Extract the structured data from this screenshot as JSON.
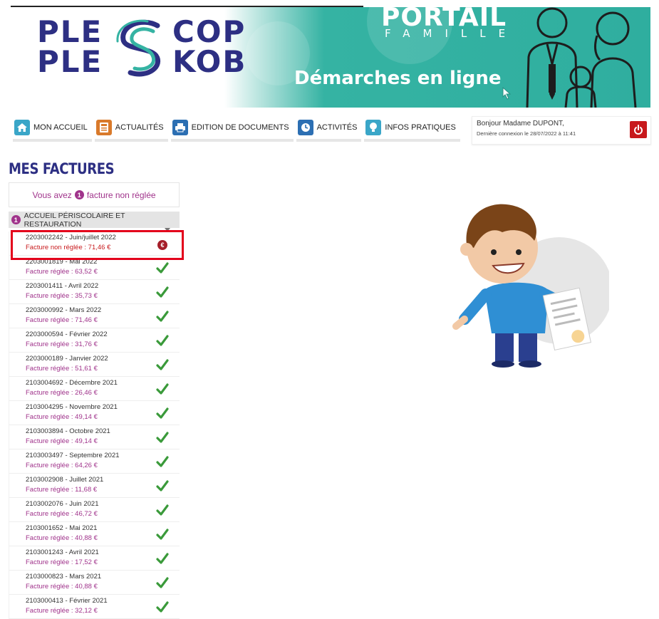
{
  "banner": {
    "logo_line1_left": "PLE",
    "logo_line1_right": "COP",
    "logo_line2_left": "PLE",
    "logo_line2_right": "KOB",
    "portail": "PORTAIL",
    "famille": "FAMILLE",
    "tagline": "Démarches en ligne"
  },
  "nav": {
    "items": [
      {
        "label": "MON ACCUEIL",
        "icon": "home-icon",
        "color": "#3aa6c8"
      },
      {
        "label": "ACTUALITÉS",
        "icon": "news-icon",
        "color": "#d97a2b"
      },
      {
        "label": "EDITION DE DOCUMENTS",
        "icon": "printer-icon",
        "color": "#2c6fb3"
      },
      {
        "label": "ACTIVITÉS",
        "icon": "clock-icon",
        "color": "#2c6fb3"
      },
      {
        "label": "INFOS PRATIQUES",
        "icon": "lightbulb-icon",
        "color": "#3aa6c8"
      }
    ]
  },
  "user": {
    "greeting": "Bonjour Madame DUPONT,",
    "last_connection": "Dernière connexion le 28/07/2022 à 11:41"
  },
  "page": {
    "title": "MES FACTURES",
    "summary_prefix": "Vous avez",
    "summary_count": "1",
    "summary_suffix": "facture non réglée",
    "section_badge": "1",
    "section_label": "ACCUEIL PÉRISCOLAIRE ET RESTAURATION"
  },
  "colors": {
    "brand_blue": "#2d2f83",
    "teal": "#2fae9f",
    "magenta": "#a0338b",
    "red": "#c8191c",
    "green": "#3a9a3a"
  },
  "invoices": [
    {
      "title": "2203002242 - Juin/juillet 2022",
      "status": "Facture non réglée : 71,46 €",
      "paid": false
    },
    {
      "title": "2203001819 - Mai 2022",
      "status": "Facture réglée : 63,52 €",
      "paid": true
    },
    {
      "title": "2203001411 - Avril 2022",
      "status": "Facture réglée : 35,73 €",
      "paid": true
    },
    {
      "title": "2203000992 - Mars 2022",
      "status": "Facture réglée : 71,46 €",
      "paid": true
    },
    {
      "title": "2203000594 - Février 2022",
      "status": "Facture réglée : 31,76 €",
      "paid": true
    },
    {
      "title": "2203000189 - Janvier 2022",
      "status": "Facture réglée : 51,61 €",
      "paid": true
    },
    {
      "title": "2103004692 - Décembre 2021",
      "status": "Facture réglée : 26,46 €",
      "paid": true
    },
    {
      "title": "2103004295 - Novembre 2021",
      "status": "Facture réglée : 49,14 €",
      "paid": true
    },
    {
      "title": "2103003894 - Octobre 2021",
      "status": "Facture réglée : 49,14 €",
      "paid": true
    },
    {
      "title": "2103003497 - Septembre 2021",
      "status": "Facture réglée : 64,26 €",
      "paid": true
    },
    {
      "title": "2103002908 - Juillet 2021",
      "status": "Facture réglée : 11,68 €",
      "paid": true
    },
    {
      "title": "2103002076 - Juin 2021",
      "status": "Facture réglée : 46,72 €",
      "paid": true
    },
    {
      "title": "2103001652 - Mai 2021",
      "status": "Facture réglée : 40,88 €",
      "paid": true
    },
    {
      "title": "2103001243 - Avril 2021",
      "status": "Facture réglée : 17,52 €",
      "paid": true
    },
    {
      "title": "2103000823 - Mars 2021",
      "status": "Facture réglée : 40,88 €",
      "paid": true
    },
    {
      "title": "2103000413 - Février 2021",
      "status": "Facture réglée : 32,12 €",
      "paid": true
    }
  ]
}
